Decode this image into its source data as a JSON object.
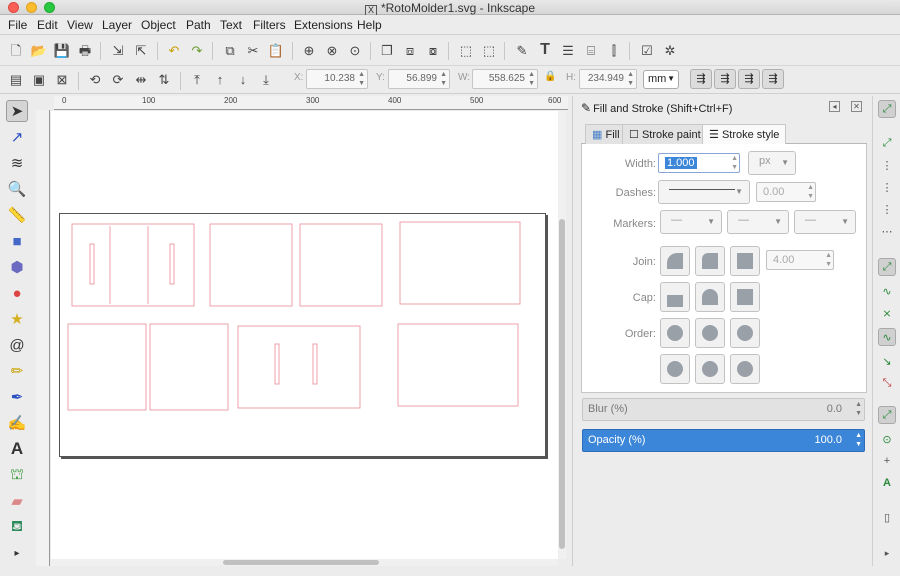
{
  "window": {
    "title": "*RotoMolder1.svg - Inkscape",
    "x_icon": "X"
  },
  "menus": [
    "File",
    "Edit",
    "View",
    "Layer",
    "Object",
    "Path",
    "Text",
    "Filters",
    "Extensions",
    "Help"
  ],
  "toolbar2": {
    "x_label": "X:",
    "x_value": "10.238",
    "y_label": "Y:",
    "y_value": "56.899",
    "w_label": "W:",
    "w_value": "558.625",
    "h_label": "H:",
    "h_value": "234.949",
    "unit": "mm"
  },
  "ruler": {
    "labels": [
      "0",
      "100",
      "200",
      "300",
      "400",
      "500",
      "600"
    ]
  },
  "dock": {
    "title": "Fill and Stroke (Shift+Ctrl+F)",
    "tabs": [
      "Fill",
      "Stroke paint",
      "Stroke style"
    ]
  },
  "stroke_style": {
    "width_label": "Width:",
    "width_value": "1.000",
    "width_unit": "px",
    "dashes_label": "Dashes:",
    "dash_offset": "0.00",
    "markers_label": "Markers:",
    "join_label": "Join:",
    "miter_value": "4.00",
    "cap_label": "Cap:",
    "order_label": "Order:"
  },
  "blur": {
    "label": "Blur (%)",
    "value": "0.0"
  },
  "opacity": {
    "label": "Opacity (%)",
    "value": "100.0"
  },
  "colors": {
    "accent": "#3b86d8",
    "parts": "#e88a95"
  }
}
